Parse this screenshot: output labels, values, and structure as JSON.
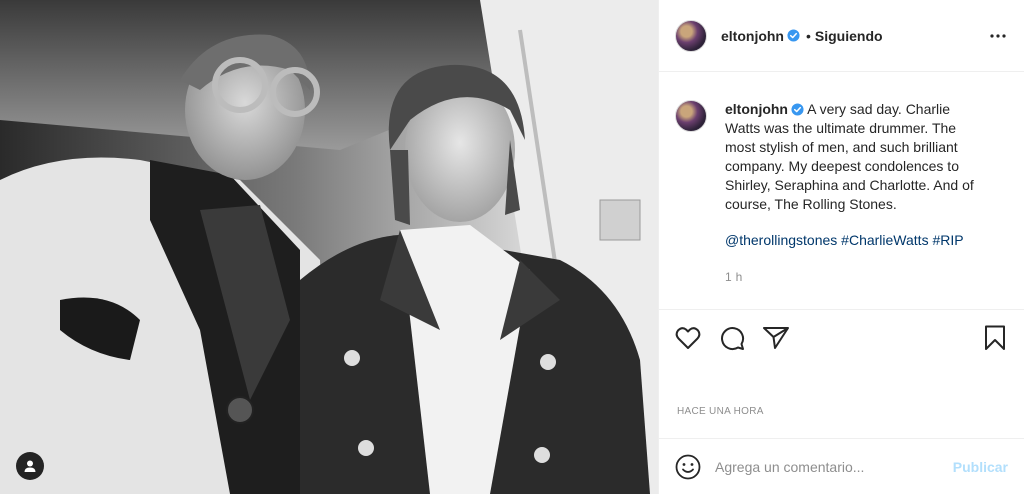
{
  "post": {
    "username": "eltonjohn",
    "follow_status": "Siguiendo",
    "dot": "•",
    "caption": "A very sad day. Charlie Watts was the ultimate drummer. The most stylish of men, and such brilliant company. My deepest condolences to Shirley, Seraphina and Charlotte. And of course, The Rolling Stones.",
    "mention": "@therollingstones",
    "hashtag_1": "#CharlieWatts",
    "hashtag_2": "#RIP",
    "comment_time": "1 h",
    "date_label": "HACE UNA HORA"
  },
  "comment_box": {
    "placeholder": "Agrega un comentario...",
    "publish_label": "Publicar"
  },
  "icons": {
    "verified": "verified-badge-icon",
    "more": "more-options-icon",
    "like": "heart-icon",
    "comment": "comment-bubble-icon",
    "share": "paper-plane-icon",
    "save": "bookmark-icon",
    "emoji": "smiley-icon",
    "tags": "user-tag-icon"
  },
  "colors": {
    "verified_blue": "#3897f0",
    "link_blue": "#00376b",
    "publish_disabled": "#b2dffc",
    "muted_text": "#8e8e8e"
  }
}
